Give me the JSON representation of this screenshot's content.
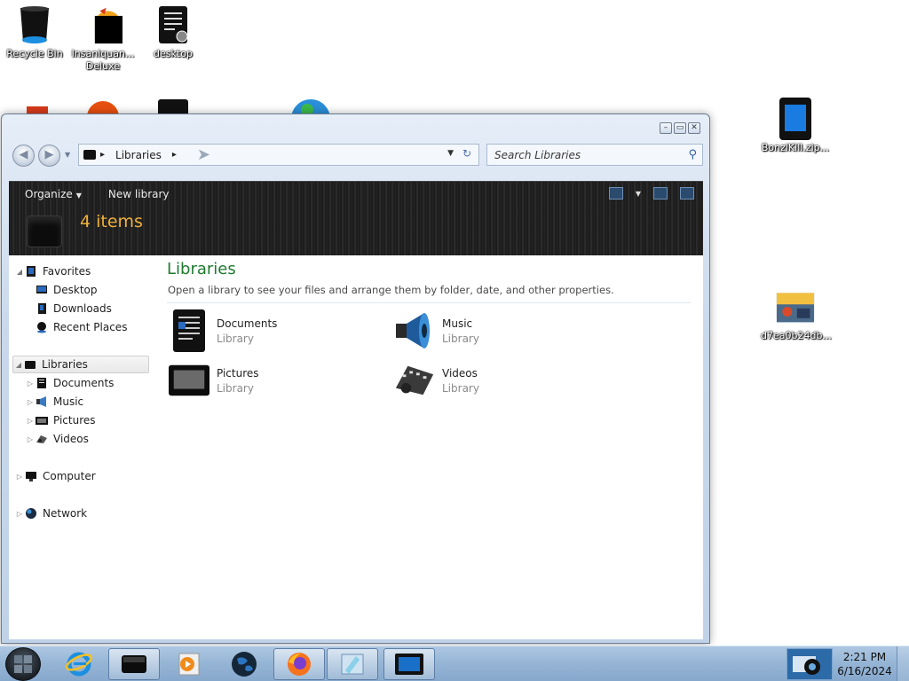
{
  "desktop": {
    "icons": [
      {
        "label": "Recycle Bin",
        "icon": "recycle-bin-icon"
      },
      {
        "label": "Insaniquan... Deluxe",
        "icon": "game-icon"
      },
      {
        "label": "desktop",
        "icon": "settings-file-icon"
      },
      {
        "label": "BonziKill.zip...",
        "icon": "zip-file-icon"
      },
      {
        "label": "d7ea0b24db...",
        "icon": "image-file-icon"
      }
    ]
  },
  "window": {
    "caption_buttons": [
      "–",
      "▭",
      "✕"
    ],
    "address": {
      "crumb": "Libraries",
      "separator": "▸"
    },
    "search": {
      "placeholder": "Search Libraries"
    },
    "toolbar": {
      "organize": "Organize",
      "new_library": "New library"
    },
    "header_count": "4 items",
    "navigation": {
      "favorites": "Favorites",
      "favorites_items": [
        "Desktop",
        "Downloads",
        "Recent Places"
      ],
      "libraries": "Libraries",
      "libraries_items": [
        "Documents",
        "Music",
        "Pictures",
        "Videos"
      ],
      "computer": "Computer",
      "network": "Network"
    },
    "main": {
      "title": "Libraries",
      "subtitle": "Open a library to see your files and arrange them by folder, date, and other properties.",
      "libraries": [
        {
          "name": "Documents",
          "type": "Library"
        },
        {
          "name": "Music",
          "type": "Library"
        },
        {
          "name": "Pictures",
          "type": "Library"
        },
        {
          "name": "Videos",
          "type": "Library"
        }
      ]
    }
  },
  "taskbar": {
    "pinned": [
      "internet-explorer-icon",
      "explorer-icon",
      "media-player-icon",
      "globe-icon",
      "firefox-icon",
      "paint-icon",
      "window-icon"
    ],
    "clock": {
      "time": "2:21 PM",
      "date": "6/16/2024"
    }
  },
  "colors": {
    "accent_title": "#1e7a2e",
    "count": "#f0b03a",
    "taskbar": "#97b6d6"
  }
}
